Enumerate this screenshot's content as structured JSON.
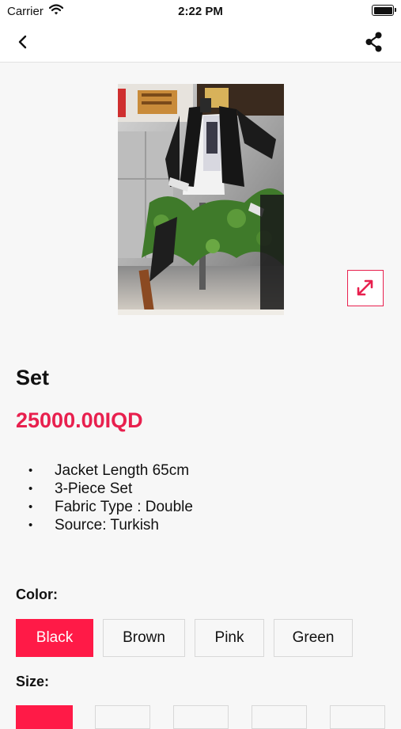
{
  "status_bar": {
    "carrier": "Carrier",
    "time": "2:22 PM"
  },
  "nav": {
    "back_icon": "chevron-left-icon",
    "share_icon": "share-icon"
  },
  "product": {
    "title": "Set",
    "price": "25000.00IQD",
    "description": [
      "Jacket Length 65cm",
      "3-Piece Set",
      "Fabric Type : Double",
      "Source: Turkish"
    ],
    "expand_icon": "expand-arrows-icon"
  },
  "color_section": {
    "label": "Color:",
    "options": [
      "Black",
      "Brown",
      "Pink",
      "Green"
    ],
    "selected": "Black"
  },
  "size_section": {
    "label": "Size:"
  },
  "accent_color": "#e8204e"
}
